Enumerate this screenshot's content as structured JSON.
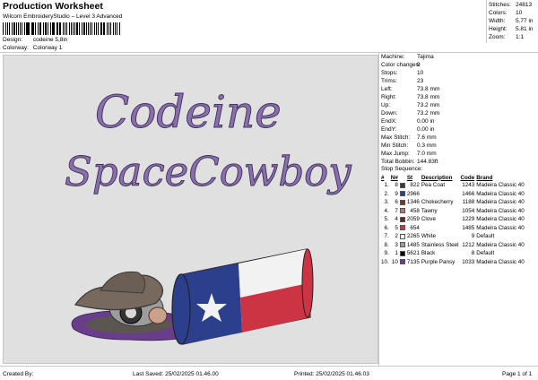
{
  "header": {
    "title": "Production Worksheet",
    "subtitle": "Wilcom EmbroideryStudio – Level 3 Advanced",
    "design_label": "Design:",
    "design_value": "codeine 5,8in",
    "colorway_label": "Colorway:",
    "colorway_value": "Colorway 1"
  },
  "summary": [
    {
      "label": "Stitches:",
      "value": "24813"
    },
    {
      "label": "Colors:",
      "value": "10"
    },
    {
      "label": "Width:",
      "value": "5.77 in"
    },
    {
      "label": "Height:",
      "value": "5.81 in"
    },
    {
      "label": "Zoom:",
      "value": "1:1"
    }
  ],
  "design": {
    "line1": "Codeine",
    "line2": "SpaceCowboy",
    "colors": {
      "text": "#8a6fae",
      "text_outline": "#3d2f55",
      "cup_blue": "#2c3f8c",
      "cup_red": "#cc3343",
      "cup_white": "#f2f2f2",
      "hat": "#77695e",
      "lean": "#6a3d8c"
    }
  },
  "params": [
    {
      "label": "Machine:",
      "value": "Tajima"
    },
    {
      "label": "Color changes:",
      "value": "9"
    },
    {
      "label": "Stops:",
      "value": "10"
    },
    {
      "label": "Trims:",
      "value": "23"
    },
    {
      "label": "Left:",
      "value": "73.8 mm"
    },
    {
      "label": "Right:",
      "value": "73.8 mm"
    },
    {
      "label": "Up:",
      "value": "73.2 mm"
    },
    {
      "label": "Down:",
      "value": "73.2 mm"
    },
    {
      "label": "EndX:",
      "value": "0.00 in"
    },
    {
      "label": "EndY:",
      "value": "0.00 in"
    },
    {
      "label": "Max Stitch:",
      "value": "7.6 mm"
    },
    {
      "label": "Min Stitch:",
      "value": "0.3 mm"
    },
    {
      "label": "Max Jump:",
      "value": "7.0 mm"
    },
    {
      "label": "Total Bobbin:",
      "value": "144.83ft"
    }
  ],
  "sequence": {
    "title": "Stop Sequence:",
    "columns": [
      "#",
      "N#",
      "",
      "St",
      "Description",
      "Code",
      "Brand"
    ],
    "rows": [
      {
        "n": "1.",
        "needle": "8",
        "color": "#3a3a3a",
        "st": "822",
        "desc": "Pea Coat",
        "code": "1243",
        "brand": "Madeira Classic 40"
      },
      {
        "n": "2.",
        "needle": "9",
        "color": "#2c3f8c",
        "st": "2966",
        "desc": "",
        "code": "1466",
        "brand": "Madeira Classic 40"
      },
      {
        "n": "3.",
        "needle": "6",
        "color": "#6b3a2a",
        "st": "1346",
        "desc": "Chokecherry",
        "code": "1188",
        "brand": "Madeira Classic 40"
      },
      {
        "n": "4.",
        "needle": "7",
        "color": "#b07a80",
        "st": "458",
        "desc": "Tawny",
        "code": "1054",
        "brand": "Madeira Classic 40"
      },
      {
        "n": "5.",
        "needle": "4",
        "color": "#5a2d27",
        "st": "2059",
        "desc": "Clove",
        "code": "1229",
        "brand": "Madeira Classic 40"
      },
      {
        "n": "6.",
        "needle": "5",
        "color": "#cc3343",
        "st": "654",
        "desc": "",
        "code": "1485",
        "brand": "Madeira Classic 40"
      },
      {
        "n": "7.",
        "needle": "2",
        "color": "#ffffff",
        "st": "2265",
        "desc": "White",
        "code": "9",
        "brand": "Default"
      },
      {
        "n": "8.",
        "needle": "3",
        "color": "#9c9c9c",
        "st": "1485",
        "desc": "Stainless Steel",
        "code": "1212",
        "brand": "Madeira Classic 40"
      },
      {
        "n": "9.",
        "needle": "1",
        "color": "#000000",
        "st": "5621",
        "desc": "Black",
        "code": "8",
        "brand": "Default"
      },
      {
        "n": "10.",
        "needle": "10",
        "color": "#6a3d8c",
        "st": "7135",
        "desc": "Purple Pansy",
        "code": "1033",
        "brand": "Madeira Classic 40"
      }
    ]
  },
  "footer": {
    "created_by": "Created By:",
    "last_saved": "Last Saved: 25/02/2025 01.46.00",
    "printed": "Printed: 25/02/2025 01.46.03",
    "page": "Page 1 of 1"
  }
}
